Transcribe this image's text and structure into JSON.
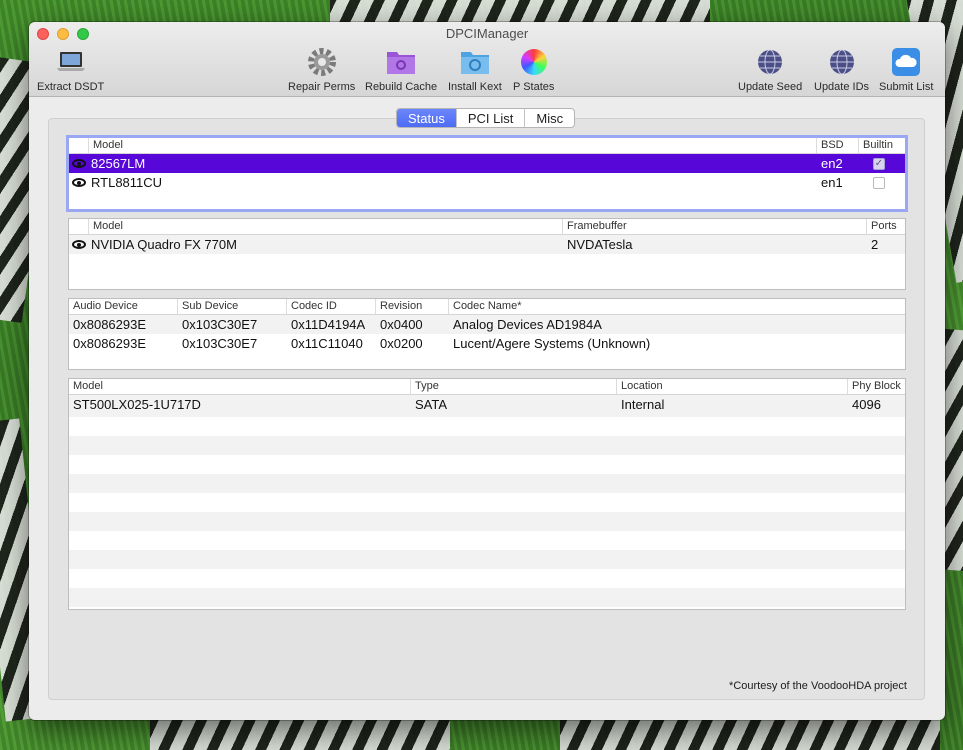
{
  "window": {
    "title": "DPCIManager"
  },
  "toolbar": {
    "extract_dsdt": {
      "label": "Extract DSDT",
      "icon": "laptop-icon"
    },
    "repair_perms": {
      "label": "Repair Perms",
      "icon": "gear-icon"
    },
    "rebuild_cache": {
      "label": "Rebuild Cache",
      "icon": "folder-icon"
    },
    "install_kext": {
      "label": "Install Kext",
      "icon": "folder-icon"
    },
    "p_states": {
      "label": "P States",
      "icon": "color-wheel-icon"
    },
    "update_seed": {
      "label": "Update Seed",
      "icon": "globe-icon"
    },
    "update_ids": {
      "label": "Update IDs",
      "icon": "globe-icon"
    },
    "submit_list": {
      "label": "Submit List",
      "icon": "cloud-icon"
    }
  },
  "tabs": [
    {
      "label": "Status",
      "active": true
    },
    {
      "label": "PCI List",
      "active": false
    },
    {
      "label": "Misc",
      "active": false
    }
  ],
  "network_table": {
    "headers": [
      "Model",
      "BSD",
      "Builtin"
    ],
    "rows": [
      {
        "model": "82567LM",
        "bsd": "en2",
        "builtin": true,
        "selected": true
      },
      {
        "model": "RTL8811CU",
        "bsd": "en1",
        "builtin": false,
        "selected": false
      }
    ]
  },
  "graphics_table": {
    "headers": [
      "Model",
      "Framebuffer",
      "Ports"
    ],
    "rows": [
      {
        "model": "NVIDIA Quadro FX 770M",
        "framebuffer": "NVDATesla",
        "ports": "2"
      }
    ]
  },
  "audio_table": {
    "headers": [
      "Audio Device",
      "Sub Device",
      "Codec ID",
      "Revision",
      "Codec Name*"
    ],
    "rows": [
      {
        "device": "0x8086293E",
        "sub": "0x103C30E7",
        "codec": "0x11D4194A",
        "rev": "0x0400",
        "name": "Analog Devices AD1984A"
      },
      {
        "device": "0x8086293E",
        "sub": "0x103C30E7",
        "codec": "0x11C11040",
        "rev": "0x0200",
        "name": "Lucent/Agere Systems (Unknown)"
      }
    ]
  },
  "storage_table": {
    "headers": [
      "Model",
      "Type",
      "Location",
      "Phy Block"
    ],
    "rows": [
      {
        "model": "ST500LX025-1U717D",
        "type": "SATA",
        "location": "Internal",
        "block": "4096"
      }
    ]
  },
  "credit": "*Courtesy of the VoodooHDA project",
  "colors": {
    "accent": "#5707d8",
    "tab_active": "#5a77f8",
    "focus_ring": "#9aa7f3"
  }
}
